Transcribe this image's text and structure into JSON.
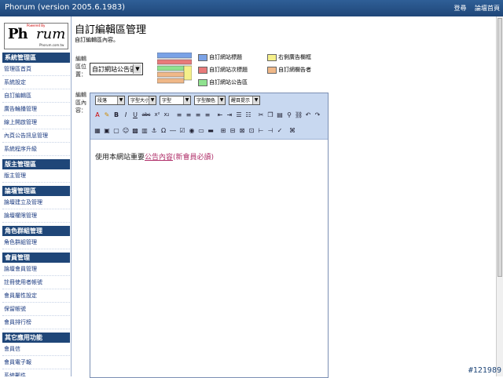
{
  "window": {
    "title": "Phorum (version 2005.6.1983)",
    "link_1": "登尋",
    "link_2": "論壇首頁"
  },
  "logo": {
    "powered": "Powered By",
    "left": "Ph",
    "right": "rum",
    "site": "Phorum.com.tw"
  },
  "sidebar": {
    "groups": [
      {
        "title": "系統管理區",
        "items": [
          "管理區首頁",
          "系統設定",
          "自訂編輯區",
          "廣告輪播管理",
          "線上開啟管理",
          "內頁公告訊息管理",
          "系統程序升級"
        ]
      },
      {
        "title": "版主管理區",
        "items": [
          "版主管理"
        ]
      },
      {
        "title": "論壇管理區",
        "items": [
          "論壇建立及管理",
          "論壇權限管理"
        ]
      },
      {
        "title": "角色群組管理",
        "items": [
          "角色群組管理"
        ]
      },
      {
        "title": "會員管理",
        "items": [
          "論壇會員管理",
          "註冊使用者帳號",
          "會員屬性設定",
          "保留帳號",
          "會員排行榜"
        ]
      },
      {
        "title": "其它應用功能",
        "items": [
          "會員信",
          "會員電子報",
          "系統郵件"
        ]
      }
    ]
  },
  "main": {
    "title": "自訂編輯區管理",
    "subtitle": "自訂編輯區內容。",
    "position_label_1": "編輯",
    "position_label_2": "區位",
    "position_label_3": "置：",
    "content_label_1": "編輯",
    "content_label_2": "區內",
    "content_label_3": "容：",
    "position_select": "自訂網站公告區",
    "legend": {
      "l1": "自訂網站標題",
      "l2": "右側廣告欄框",
      "l3": "自訂網站次標題",
      "l4": "自訂網欄告者",
      "l5": "自訂網站公告區"
    },
    "colors": {
      "blue": "#7aa2e6",
      "red": "#e87a7a",
      "yellow": "#f5f08a",
      "green": "#8fe28f",
      "orange": "#f0b888"
    }
  },
  "toolbar": {
    "paragraph": "段落",
    "font_size": "字型大小",
    "font": "字型",
    "font_color": "字型顏色",
    "back_color": "醒目提示",
    "bold": "B",
    "italic": "I",
    "underline": "U",
    "strike": "abc",
    "sup": "x²",
    "sub": "x₂"
  },
  "editor": {
    "text_prefix": "使用本網站重要",
    "link": "公告內容",
    "suffix": "(新會員必讀)"
  },
  "stamp": "#121989"
}
